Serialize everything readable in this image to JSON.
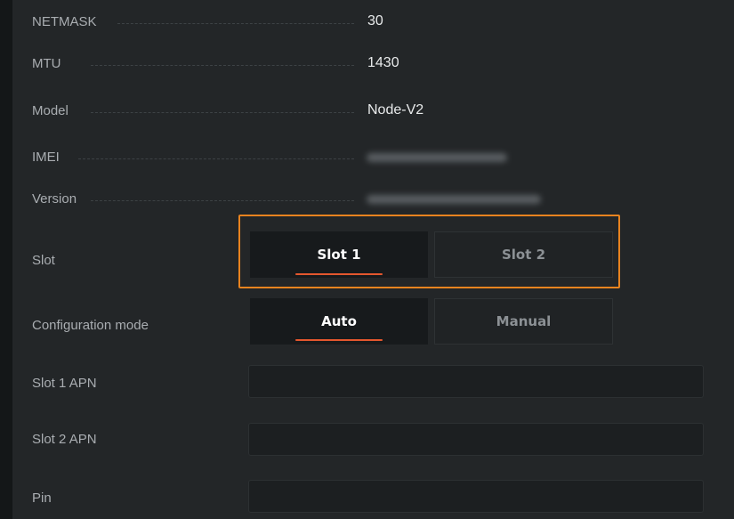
{
  "info_rows": [
    {
      "label": "NETMASK",
      "value": "30"
    },
    {
      "label": "MTU",
      "value": "1430"
    },
    {
      "label": "Model",
      "value": "Node-V2"
    },
    {
      "label": "IMEI",
      "value": ""
    },
    {
      "label": "Version",
      "value": ""
    }
  ],
  "slot": {
    "label": "Slot",
    "options": [
      "Slot 1",
      "Slot 2"
    ],
    "selected": "Slot 1"
  },
  "config_mode": {
    "label": "Configuration mode",
    "options": [
      "Auto",
      "Manual"
    ],
    "selected": "Auto"
  },
  "fields": [
    {
      "label": "Slot 1 APN",
      "value": ""
    },
    {
      "label": "Slot 2 APN",
      "value": ""
    },
    {
      "label": "Pin",
      "value": ""
    }
  ],
  "colors": {
    "accent_underline": "#e4572e",
    "focus_ring": "#e8831f",
    "panel_background": "#232628"
  }
}
